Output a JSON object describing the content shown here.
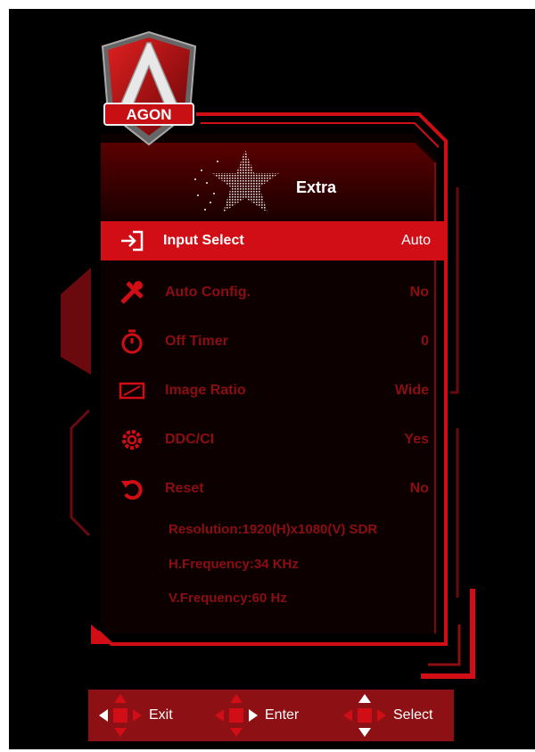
{
  "osd": {
    "brand": "AGON",
    "section_title": "Extra",
    "section_icon": "star-icon"
  },
  "menu": {
    "items": [
      {
        "label": "Input Select",
        "value": "Auto",
        "icon": "input-icon",
        "selected": true
      },
      {
        "label": "Auto Config.",
        "value": "No",
        "icon": "tools-icon",
        "selected": false
      },
      {
        "label": "Off Timer",
        "value": "0",
        "icon": "timer-icon",
        "selected": false
      },
      {
        "label": "Image Ratio",
        "value": "Wide",
        "icon": "aspect-ratio-icon",
        "selected": false
      },
      {
        "label": "DDC/CI",
        "value": "Yes",
        "icon": "gear-icon",
        "selected": false
      },
      {
        "label": "Reset",
        "value": "No",
        "icon": "reset-icon",
        "selected": false
      }
    ]
  },
  "info": {
    "resolution": "Resolution:1920(H)x1080(V) SDR",
    "h_frequency": "H.Frequency:34 KHz",
    "v_frequency": "V.Frequency:60 Hz"
  },
  "footer": {
    "exit_label": "Exit",
    "enter_label": "Enter",
    "select_label": "Select"
  },
  "colors": {
    "accent": "#d10d15",
    "dim_text": "#8a0e12",
    "background": "#000000"
  }
}
